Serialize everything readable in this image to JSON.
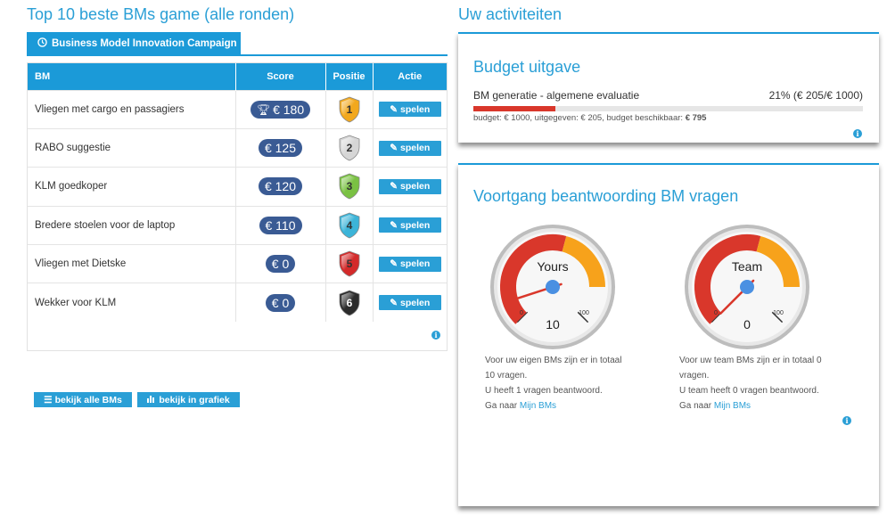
{
  "left": {
    "title": "Top 10 beste BMs game (alle ronden)",
    "campaign_tab": "Business Model Innovation Campaign",
    "columns": {
      "bm": "BM",
      "score": "Score",
      "position": "Positie",
      "action": "Actie"
    },
    "rows": [
      {
        "name": "Vliegen met cargo en passagiers",
        "score": "€ 180",
        "trophy": true,
        "position": "1",
        "color": "#f2a81d",
        "action": "spelen"
      },
      {
        "name": "RABO suggestie",
        "score": "€ 125",
        "trophy": false,
        "position": "2",
        "color": "#d6d6d6",
        "action": "spelen"
      },
      {
        "name": "KLM goedkoper",
        "score": "€ 120",
        "trophy": false,
        "position": "3",
        "color": "#7ac143",
        "action": "spelen"
      },
      {
        "name": "Bredere stoelen voor de laptop",
        "score": "€ 110",
        "trophy": false,
        "position": "4",
        "color": "#3cb4d8",
        "action": "spelen"
      },
      {
        "name": "Vliegen met Dietske",
        "score": "€ 0",
        "trophy": false,
        "position": "5",
        "color": "#d32a2a",
        "action": "spelen"
      },
      {
        "name": "Wekker voor KLM",
        "score": "€ 0",
        "trophy": false,
        "position": "6",
        "color": "#2b2b2b",
        "action": "spelen"
      }
    ],
    "btn_all": "bekijk alle BMs",
    "btn_chart": "bekijk in grafiek"
  },
  "right": {
    "title": "Uw activiteiten",
    "budget": {
      "title": "Budget uitgave",
      "label": "BM generatie - algemene evaluatie",
      "percent_text": "21% (€ 205/€ 1000)",
      "fill": 0.21,
      "sub_prefix": "budget: € 1000, uitgegeven: € 205, budget beschikbaar: ",
      "sub_available": "€ 795"
    },
    "progress": {
      "title": "Voortgang beantwoording BM vragen",
      "gauges": [
        {
          "label": "Yours",
          "value": "10",
          "min_label": "0",
          "max_label": "100",
          "line1": "Voor uw eigen BMs zijn er in totaal",
          "line2": "10 vragen.",
          "line3": "U heeft 1 vragen beantwoord.",
          "goto": "Ga naar ",
          "link": "Mijn BMs"
        },
        {
          "label": "Team",
          "value": "0",
          "min_label": "0",
          "max_label": "100",
          "line1": "Voor uw team BMs zijn er in totaal 0",
          "line2": "vragen.",
          "line3": "U team heeft 0 vragen beantwoord.",
          "goto": "Ga naar ",
          "link": "Mijn BMs"
        }
      ]
    }
  },
  "colors": {
    "accent": "#1b9ad8",
    "badge": "#3a5b94",
    "danger": "#d9372b",
    "orange": "#f7a21b"
  }
}
